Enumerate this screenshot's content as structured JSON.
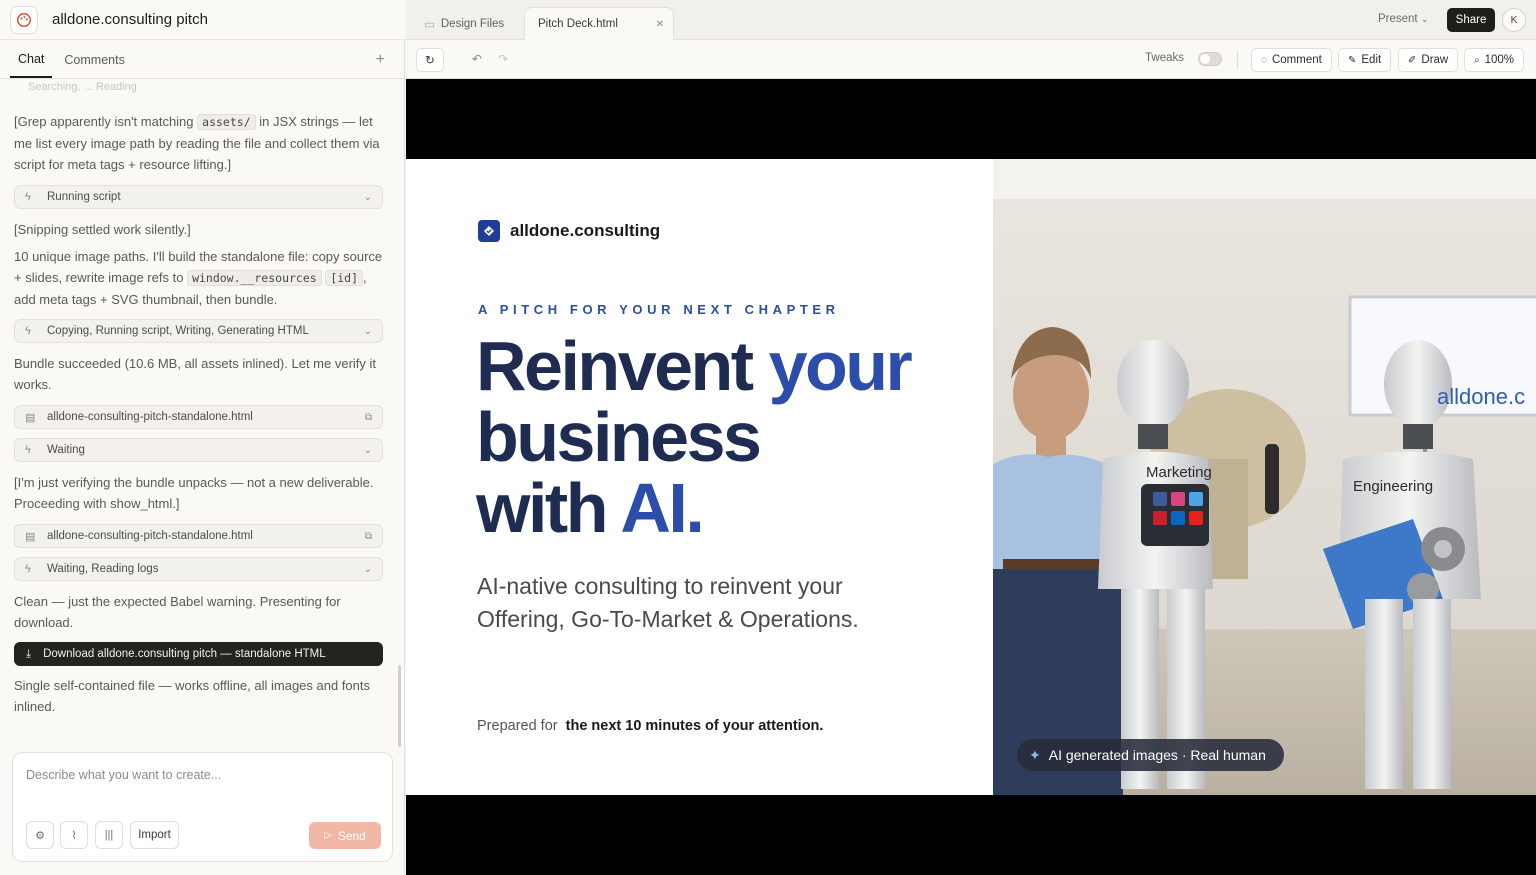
{
  "project": {
    "title": "alldone.consulting pitch"
  },
  "left_tabs": [
    "Chat",
    "Comments"
  ],
  "chat": {
    "faded_line": "Searching, ...  Reading",
    "grep_msg_a": "[Grep apparently isn't matching",
    "grep_code": "assets/",
    "grep_msg_b": "in JSX strings — let me list every image path by reading the file and collect them via script for meta tags + resource lifting.]",
    "tool1": "Running script",
    "snip_msg": "[Snipping settled work silently.]",
    "paths_msg_a": "10 unique image paths. I'll build the standalone file: copy source + slides, rewrite image refs to",
    "paths_code1": "window.__resources",
    "paths_code2": "[id]",
    "paths_msg_b": ", add meta tags + SVG thumbnail, then bundle.",
    "tool2": "Copying, Running script, Writing, Generating HTML",
    "bundle_msg": "Bundle succeeded (10.6 MB, all assets inlined). Let me verify it works.",
    "file1": "alldone-consulting-pitch-standalone.html",
    "tool3": "Waiting",
    "verify_msg": "[I'm just verifying the bundle unpacks — not a new deliverable. Proceeding with show_html.]",
    "file2": "alldone-consulting-pitch-standalone.html",
    "tool4": "Waiting, Reading logs",
    "clean_msg": "Clean — just the expected Babel warning. Presenting for download.",
    "download_label": "Download alldone.consulting pitch — standalone HTML",
    "final_msg": "Single self-contained file — works offline, all images and fonts inlined."
  },
  "composer": {
    "placeholder": "Describe what you want to create...",
    "import_label": "Import",
    "send_label": "Send"
  },
  "file_tabs": {
    "design_files": "Design Files",
    "active": "Pitch Deck.html"
  },
  "top_actions": {
    "present": "Present",
    "share": "Share",
    "avatar": "K"
  },
  "toolbar": {
    "tweaks": "Tweaks",
    "comment": "Comment",
    "edit": "Edit",
    "draw": "Draw",
    "zoom": "100%"
  },
  "slide": {
    "brand": "alldone.consulting",
    "kicker": "A PITCH FOR YOUR NEXT CHAPTER",
    "headline_1a": "Reinvent ",
    "headline_1b": "your",
    "headline_2": "business",
    "headline_3a": "with ",
    "headline_3b": "AI.",
    "sub_1": "AI-native consulting to reinvent your",
    "sub_2": "Offering, Go-To-Market & Operations.",
    "prepared_label": "Prepared for",
    "prepared_value": "the next 10 minutes of your attention.",
    "photo_screen_text": "alldone.c",
    "robot1_label": "Marketing",
    "robot2_label": "Engineering",
    "badge": "AI generated images · Real human"
  },
  "colors": {
    "accent": "#2c4eaa",
    "navy": "#1f2c52",
    "send": "#f3b7a6",
    "dark": "#24231f"
  }
}
